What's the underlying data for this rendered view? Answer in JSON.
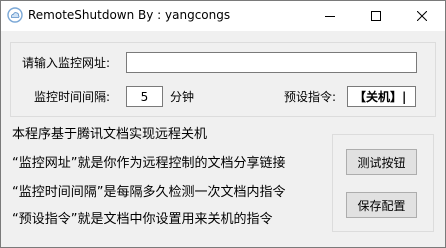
{
  "window": {
    "title": "RemoteShutdown  By : yangcongs"
  },
  "form": {
    "url_label": "请输入监控网址:",
    "url_value": "",
    "interval_label": "监控时间间隔:",
    "interval_value": "5",
    "interval_unit": "分钟",
    "command_label": "预设指令:",
    "command_value": "【关机】|"
  },
  "description": {
    "lines": [
      "本程序基于腾讯文档实现远程关机",
      "“监控网址”就是你作为远程控制的文档分享链接",
      "“监控时间间隔”是每隔多久检测一次文档内指令",
      "“预设指令”就是文档中你设置用来关机的指令"
    ]
  },
  "buttons": {
    "test_label": "测试按钮",
    "save_label": "保存配置"
  },
  "icons": {
    "app": "app-cloud-icon",
    "minimize": "minimize-icon",
    "maximize": "maximize-icon",
    "close": "close-icon"
  }
}
